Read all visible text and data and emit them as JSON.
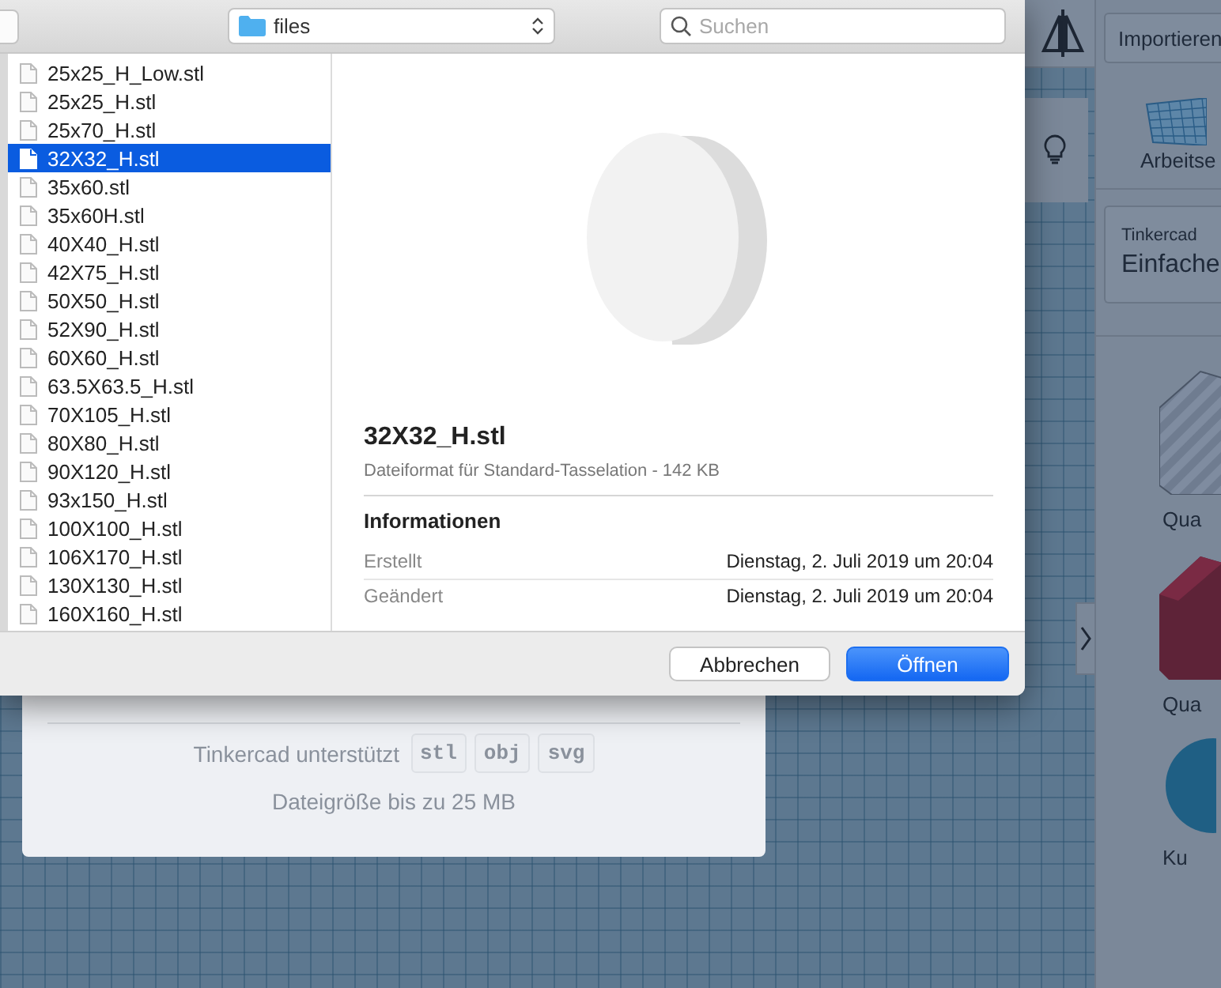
{
  "dialog": {
    "location": "files",
    "search": {
      "placeholder": "Suchen"
    },
    "files": [
      {
        "name": "25x25_H_Low.stl",
        "selected": false
      },
      {
        "name": "25x25_H.stl",
        "selected": false
      },
      {
        "name": "25x70_H.stl",
        "selected": false
      },
      {
        "name": "32X32_H.stl",
        "selected": true
      },
      {
        "name": "35x60.stl",
        "selected": false
      },
      {
        "name": "35x60H.stl",
        "selected": false
      },
      {
        "name": "40X40_H.stl",
        "selected": false
      },
      {
        "name": "42X75_H.stl",
        "selected": false
      },
      {
        "name": "50X50_H.stl",
        "selected": false
      },
      {
        "name": "52X90_H.stl",
        "selected": false
      },
      {
        "name": "60X60_H.stl",
        "selected": false
      },
      {
        "name": "63.5X63.5_H.stl",
        "selected": false
      },
      {
        "name": "70X105_H.stl",
        "selected": false
      },
      {
        "name": "80X80_H.stl",
        "selected": false
      },
      {
        "name": "90X120_H.stl",
        "selected": false
      },
      {
        "name": "93x150_H.stl",
        "selected": false
      },
      {
        "name": "100X100_H.stl",
        "selected": false
      },
      {
        "name": "106X170_H.stl",
        "selected": false
      },
      {
        "name": "130X130_H.stl",
        "selected": false
      },
      {
        "name": "160X160_H.stl",
        "selected": false
      }
    ],
    "preview": {
      "filename": "32X32_H.stl",
      "description": "Dateiformat für Standard-Tasselation - 142 KB",
      "section": "Informationen",
      "info": [
        {
          "label": "Erstellt",
          "value": "Dienstag, 2. Juli 2019 um 20:04"
        },
        {
          "label": "Geändert",
          "value": "Dienstag, 2. Juli 2019 um 20:04"
        }
      ]
    },
    "buttons": [
      {
        "label": "Abbrechen",
        "primary": false
      },
      {
        "label": "Öffnen",
        "primary": true
      }
    ]
  },
  "import_card": {
    "supports_label": "Tinkercad unterstützt",
    "formats": [
      "stl",
      "obj",
      "svg"
    ],
    "size_note": "Dateigröße bis zu 25 MB"
  },
  "sidebar": {
    "import_button": "Importieren",
    "workplane_label": "Arbeitse",
    "library": {
      "source": "Tinkercad",
      "category": "Einfache"
    },
    "shapes": [
      {
        "kind": "box-striped",
        "label": "Qua"
      },
      {
        "kind": "box",
        "label": "Qua"
      },
      {
        "kind": "sphere",
        "label": "Ku"
      }
    ]
  }
}
